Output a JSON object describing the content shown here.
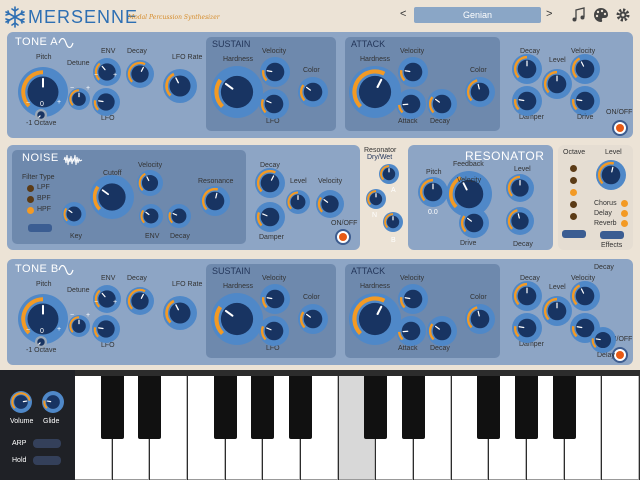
{
  "header": {
    "app_title": "MERSENNE",
    "subtitle": "Modal Percussion Synthesizer",
    "preset_name": "Genian",
    "prev_label": "<",
    "next_label": ">"
  },
  "tone_a": {
    "title": "TONE A",
    "pitch": "Pitch",
    "detune": "Detune",
    "env": "ENV",
    "lfo": "LFO",
    "decay": "Decay",
    "lfo_rate": "LFO\nRate",
    "octave": "-1 Octave",
    "pitch_value": "0",
    "minus": "−",
    "plus": "+",
    "sustain": {
      "title": "SUSTAIN",
      "hardness": "Hardness",
      "velocity": "Velocity",
      "color": "Color",
      "lfo": "LFO"
    },
    "attack": {
      "title": "ATTACK",
      "hardness": "Hardness",
      "velocity": "Velocity",
      "color": "Color",
      "attack": "Attack",
      "decay": "Decay"
    },
    "out": {
      "decay": "Decay",
      "velocity": "Velocity",
      "level": "Level",
      "damper": "Damper",
      "drive": "Drive",
      "onoff": "ON/OFF"
    }
  },
  "noise": {
    "title": "NOISE",
    "filter_type": "Filter Type",
    "filters": [
      "LPF",
      "BPF",
      "HPF"
    ],
    "cutoff": "Cutoff",
    "velocity": "Velocity",
    "resonance": "Resonance",
    "key": "Key",
    "env": "ENV",
    "decay": "Decay",
    "out": {
      "decay": "Decay",
      "level": "Level",
      "velocity": "Velocity",
      "damper": "Damper",
      "onoff": "ON/OFF"
    }
  },
  "resonator": {
    "title": "RESONATOR",
    "drywet_small": "Resonator",
    "drywet": "Dry/Wet",
    "pitch": "Pitch",
    "feedback": "Feedback",
    "velocity": "Velocity",
    "level": "Level",
    "drive": "Drive",
    "decay": "Decay",
    "pitch_value": "0.0",
    "a": "A",
    "n": "N",
    "b": "B"
  },
  "master": {
    "octave": "Octave",
    "level": "Level",
    "effects": [
      "Chorus",
      "Delay",
      "Reverb"
    ],
    "effects_label": "Effects"
  },
  "tone_b": {
    "title": "TONE B",
    "pitch": "Pitch",
    "detune": "Detune",
    "env": "ENV",
    "lfo": "LFO",
    "decay": "Decay",
    "lfo_rate": "LFO\nRate",
    "octave": "-1 Octave",
    "pitch_value": "0",
    "sustain": {
      "title": "SUSTAIN",
      "hardness": "Hardness",
      "velocity": "Velocity",
      "color": "Color",
      "lfo": "LFO"
    },
    "attack": {
      "title": "ATTACK",
      "hardness": "Hardness",
      "velocity": "Velocity",
      "color": "Color",
      "attack": "Attack",
      "decay": "Decay"
    },
    "out": {
      "decay": "Decay",
      "velocity": "Velocity",
      "level": "Level",
      "damper": "Damper",
      "delay": "Delay",
      "onoff": "ON/OFF"
    }
  },
  "bottom": {
    "volume": "Volume",
    "glide": "Glide",
    "arp": "ARP",
    "hold": "Hold"
  },
  "colors": {
    "panel": "#8da5c5",
    "sub_panel": "#6e89ad",
    "knob_ring": "#4f88c8",
    "knob_center": "#183462",
    "accent_orange": "#f39a24",
    "background": "#ece3d6"
  },
  "icons": {
    "snowflake": "snowflake-icon",
    "music": "music-notes-icon",
    "palette": "palette-icon",
    "settings": "gear-icon"
  }
}
